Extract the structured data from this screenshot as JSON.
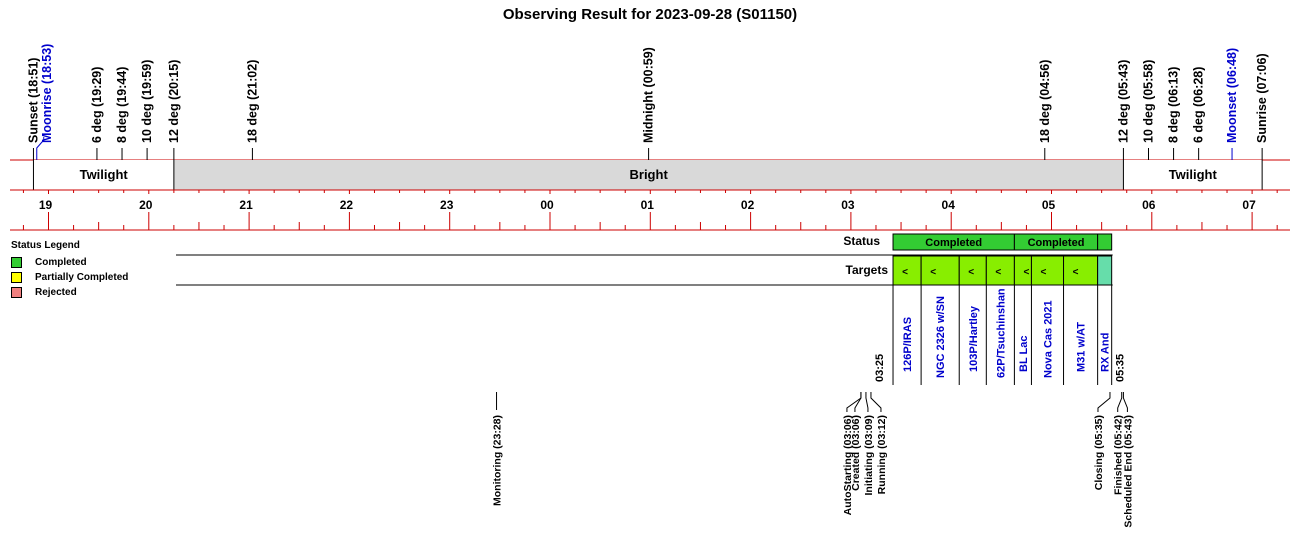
{
  "title": "Observing Result for 2023-09-28 (S01150)",
  "legend": {
    "heading": "Status Legend",
    "items": [
      {
        "label": "Completed",
        "color": "#33cc33"
      },
      {
        "label": "Partially Completed",
        "color": "#ffff00"
      },
      {
        "label": "Rejected",
        "color": "#f08080"
      }
    ]
  },
  "events_top": [
    {
      "label": "Sunset (18:51)",
      "hour": 18.85,
      "color": "#000000"
    },
    {
      "label": "Moonrise (18:53)",
      "hour": 18.883,
      "color": "#0000cc"
    },
    {
      "label": "6 deg (19:29)",
      "hour": 19.483,
      "color": "#000000"
    },
    {
      "label": "8 deg (19:44)",
      "hour": 19.733,
      "color": "#000000"
    },
    {
      "label": "10 deg (19:59)",
      "hour": 19.983,
      "color": "#000000"
    },
    {
      "label": "12 deg (20:15)",
      "hour": 20.25,
      "color": "#000000"
    },
    {
      "label": "18 deg (21:02)",
      "hour": 21.033,
      "color": "#000000"
    },
    {
      "label": "Midnight (00:59)",
      "hour": 24.983,
      "color": "#000000"
    },
    {
      "label": "18 deg (04:56)",
      "hour": 28.933,
      "color": "#000000"
    },
    {
      "label": "12 deg (05:43)",
      "hour": 29.717,
      "color": "#000000"
    },
    {
      "label": "10 deg (05:58)",
      "hour": 29.967,
      "color": "#000000"
    },
    {
      "label": "8 deg (06:13)",
      "hour": 30.217,
      "color": "#000000"
    },
    {
      "label": "6 deg (06:28)",
      "hour": 30.467,
      "color": "#000000"
    },
    {
      "label": "Moonset (06:48)",
      "hour": 30.8,
      "color": "#0000cc"
    },
    {
      "label": "Sunrise (07:06)",
      "hour": 31.1,
      "color": "#000000"
    }
  ],
  "sky_bands": [
    {
      "label": "Twilight",
      "start": 18.85,
      "end": 20.25,
      "fill": "#ffffff"
    },
    {
      "label": "Bright",
      "start": 20.25,
      "end": 29.717,
      "fill": "#d9d9d9"
    },
    {
      "label": "Twilight",
      "start": 29.717,
      "end": 31.1,
      "fill": "#ffffff"
    }
  ],
  "hour_labels": [
    "19",
    "20",
    "21",
    "22",
    "23",
    "00",
    "01",
    "02",
    "03",
    "04",
    "05",
    "06",
    "07"
  ],
  "rows": {
    "status_label": "Status",
    "targets_label": "Targets"
  },
  "status_blocks": [
    {
      "label": "Completed",
      "start": 3.42,
      "end": 4.63,
      "color": "#33cc33"
    },
    {
      "label": "Completed",
      "start": 4.63,
      "end": 5.46,
      "color": "#33cc33"
    },
    {
      "label": "",
      "start": 5.46,
      "end": 5.6,
      "color": "#33cc33"
    }
  ],
  "targets": [
    {
      "name": "126P/IRAS",
      "start": 3.42,
      "end": 3.7,
      "color": "#88ee00",
      "mark": "<"
    },
    {
      "name": "NGC 2326 w/SN",
      "start": 3.7,
      "end": 4.08,
      "color": "#88ee00",
      "mark": "<"
    },
    {
      "name": "103P/Hartley",
      "start": 4.08,
      "end": 4.35,
      "color": "#88ee00",
      "mark": "<"
    },
    {
      "name": "62P/Tsuchinshan",
      "start": 4.35,
      "end": 4.63,
      "color": "#88ee00",
      "mark": "<"
    },
    {
      "name": "BL Lac",
      "start": 4.63,
      "end": 4.8,
      "color": "#88ee00",
      "mark": "<"
    },
    {
      "name": "Nova Cas 2021",
      "start": 4.8,
      "end": 5.12,
      "color": "#88ee00",
      "mark": "<"
    },
    {
      "name": "M31 w/AT",
      "start": 5.12,
      "end": 5.46,
      "color": "#88ee00",
      "mark": "<"
    },
    {
      "name": "RX And",
      "start": 5.46,
      "end": 5.6,
      "color": "#66ddaa",
      "mark": ""
    }
  ],
  "run_times": {
    "start": "03:25",
    "end": "05:35"
  },
  "events_bottom": [
    {
      "label": "Monitoring (23:28)",
      "hour": 23.467
    },
    {
      "label": "AutoStarting (03:06)",
      "hour": 27.1
    },
    {
      "label": "Created (03:06)",
      "hour": 27.1
    },
    {
      "label": "Initiating (03:09)",
      "hour": 27.15
    },
    {
      "label": "Running (03:12)",
      "hour": 27.2
    },
    {
      "label": "Closing (05:35)",
      "hour": 29.583
    },
    {
      "label": "Finished (05:42)",
      "hour": 29.7
    },
    {
      "label": "Scheduled End (05:43)",
      "hour": 29.717
    }
  ]
}
